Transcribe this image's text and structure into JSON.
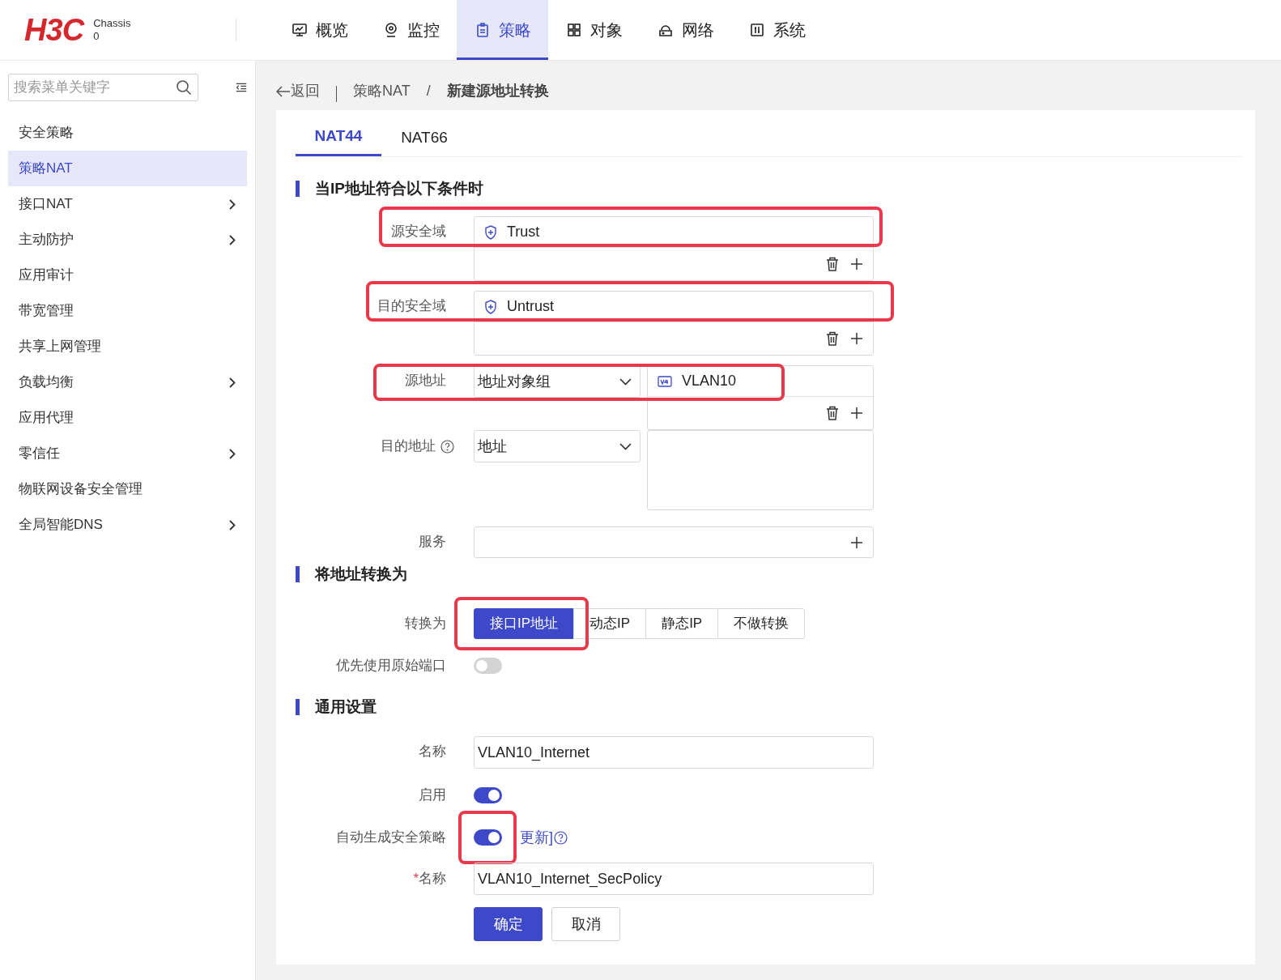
{
  "header": {
    "logo": "H3C",
    "device": [
      "Chassis",
      "0"
    ],
    "nav": [
      {
        "label": "概览",
        "kind": "monitor",
        "selected": false
      },
      {
        "label": "监控",
        "kind": "pin",
        "selected": false
      },
      {
        "label": "策略",
        "kind": "clipboard",
        "selected": true
      },
      {
        "label": "对象",
        "kind": "grid",
        "selected": false
      },
      {
        "label": "网络",
        "kind": "network",
        "selected": false
      },
      {
        "label": "系统",
        "kind": "system",
        "selected": false
      }
    ]
  },
  "sidebar": {
    "search": {
      "placeholder": "搜索菜单关键字"
    },
    "items": [
      {
        "label": "安全策略",
        "selected": false,
        "expandable": false
      },
      {
        "label": "策略NAT",
        "selected": true,
        "expandable": false
      },
      {
        "label": "接口NAT",
        "selected": false,
        "expandable": true
      },
      {
        "label": "主动防护",
        "selected": false,
        "expandable": true
      },
      {
        "label": "应用审计",
        "selected": false,
        "expandable": false
      },
      {
        "label": "带宽管理",
        "selected": false,
        "expandable": false
      },
      {
        "label": "共享上网管理",
        "selected": false,
        "expandable": false
      },
      {
        "label": "负载均衡",
        "selected": false,
        "expandable": true
      },
      {
        "label": "应用代理",
        "selected": false,
        "expandable": false
      },
      {
        "label": "零信任",
        "selected": false,
        "expandable": true
      },
      {
        "label": "物联网设备安全管理",
        "selected": false,
        "expandable": false
      },
      {
        "label": "全局智能DNS",
        "selected": false,
        "expandable": true
      }
    ]
  },
  "breadcrumb": {
    "back": "返回",
    "separator": "/",
    "items": [
      "策略NAT",
      "新建源地址转换"
    ]
  },
  "tabs": [
    {
      "label": "NAT44",
      "selected": true
    },
    {
      "label": "NAT66",
      "selected": false
    }
  ],
  "conditions": {
    "title": "当IP地址符合以下条件时",
    "source_zone": {
      "label": "源安全域",
      "values": [
        "Trust"
      ],
      "highlighted": true
    },
    "dest_zone": {
      "label": "目的安全域",
      "values": [
        "Untrust"
      ],
      "highlighted": true
    },
    "source_address": {
      "label": "源地址",
      "type": "地址对象组",
      "values": [
        "VLAN10"
      ],
      "highlighted": true
    },
    "dest_address": {
      "label": "目的地址",
      "type": "地址",
      "help": true
    },
    "service": {
      "label": "服务"
    }
  },
  "translation": {
    "title": "将地址转换为",
    "label": "转换为",
    "highlighted": true,
    "options": [
      {
        "label": "接口IP地址",
        "selected": true
      },
      {
        "label": "动态IP",
        "selected": false
      },
      {
        "label": "静态IP",
        "selected": false
      },
      {
        "label": "不做转换",
        "selected": false
      }
    ],
    "prefer_port": {
      "label": "优先使用原始端口",
      "on": false
    }
  },
  "general": {
    "title": "通用设置",
    "name": {
      "label": "名称",
      "value": "VLAN10_Internet"
    },
    "enable": {
      "label": "启用",
      "on": true
    },
    "auto_policy": {
      "label": "自动生成安全策略",
      "on": true,
      "highlighted": true,
      "link": "更新]"
    },
    "policy_name": {
      "label": "名称",
      "required_mark": "*",
      "value": "VLAN10_Internet_SecPolicy"
    }
  },
  "buttons": [
    {
      "label": "确定",
      "kind": "primary"
    },
    {
      "label": "取消",
      "kind": "default"
    }
  ]
}
